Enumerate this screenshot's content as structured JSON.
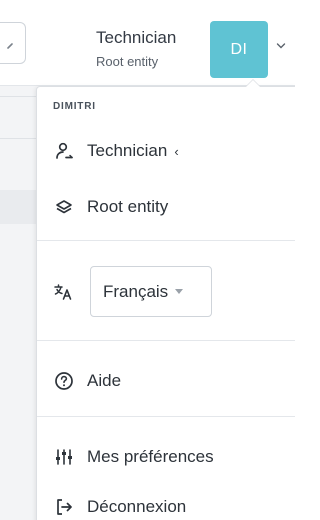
{
  "header": {
    "role": "Technician",
    "entity": "Root entity",
    "avatar_initials": "DI"
  },
  "colors": {
    "avatar_bg": "#5fc3d3",
    "divider": "#e4e7eb"
  },
  "dropdown": {
    "user_label": "DIMITRI",
    "items": {
      "profile": {
        "label": "Technician",
        "icon": "user-switch-icon"
      },
      "entity": {
        "label": "Root entity",
        "icon": "layers-icon"
      },
      "language": {
        "icon": "translate-icon",
        "selected": "Français"
      },
      "help": {
        "label": "Aide",
        "icon": "help-circle-icon"
      },
      "preferences": {
        "label": "Mes préférences",
        "icon": "sliders-icon"
      },
      "logout": {
        "label": "Déconnexion",
        "icon": "logout-icon"
      }
    }
  }
}
